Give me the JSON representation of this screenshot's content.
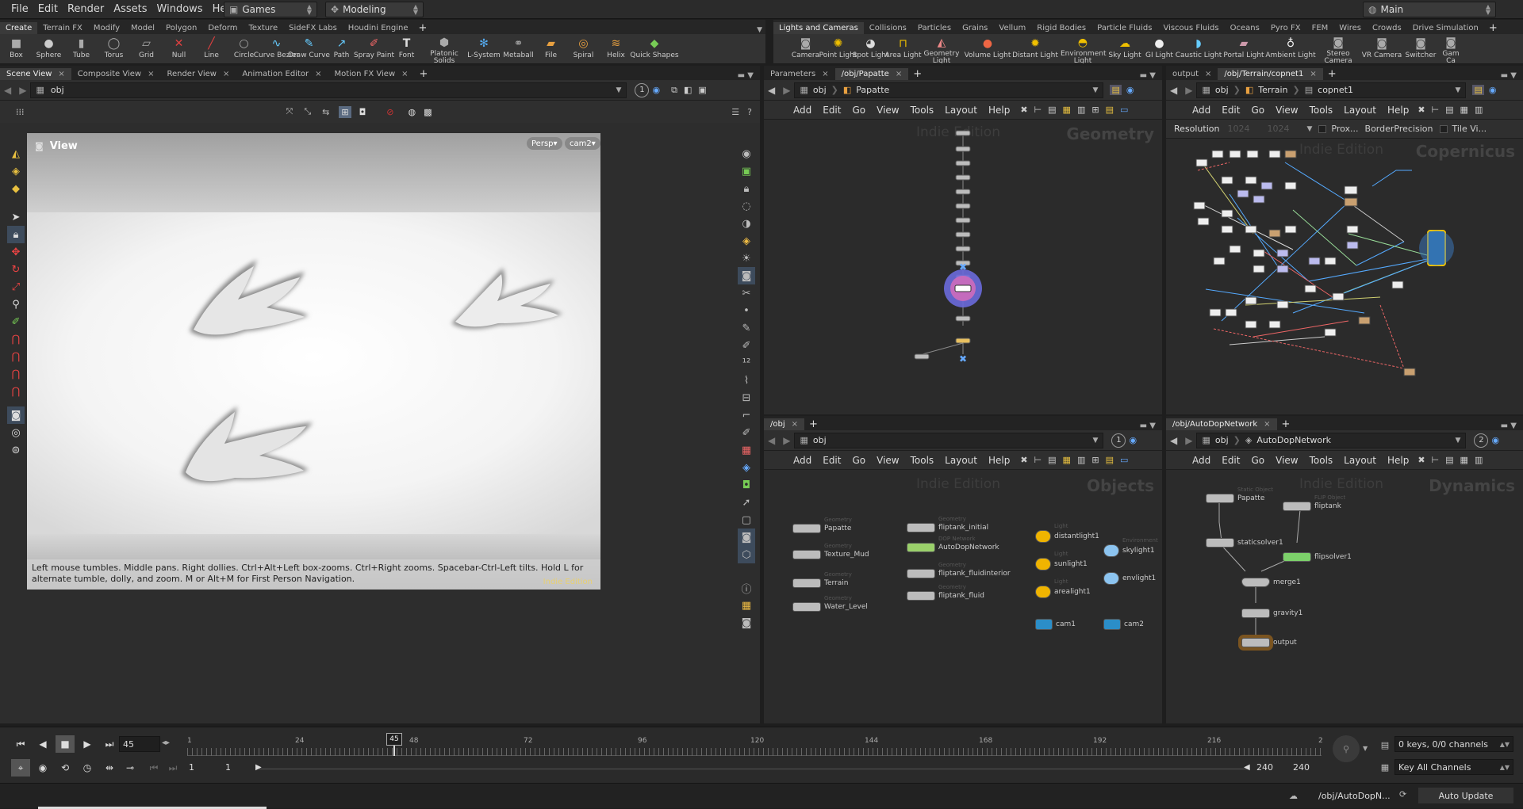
{
  "menubar": {
    "items": [
      "File",
      "Edit",
      "Render",
      "Assets",
      "Windows",
      "Help"
    ],
    "desktop": "Games",
    "context": "Modeling",
    "main": "Main"
  },
  "shelf_left": {
    "tabs": [
      "Create",
      "Terrain FX",
      "Modify",
      "Model",
      "Polygon",
      "Deform",
      "Texture",
      "SideFX Labs",
      "Houdini Engine"
    ],
    "tools": [
      "Box",
      "Sphere",
      "Tube",
      "Torus",
      "Grid",
      "Null",
      "Line",
      "Circle",
      "Curve Bezier",
      "Draw Curve",
      "Path",
      "Spray Paint",
      "Font",
      "Platonic Solids",
      "L-System",
      "Metaball",
      "File",
      "Spiral",
      "Helix",
      "Quick Shapes"
    ]
  },
  "shelf_right": {
    "tabs": [
      "Lights and Cameras",
      "Collisions",
      "Particles",
      "Grains",
      "Vellum",
      "Rigid Bodies",
      "Particle Fluids",
      "Viscous Fluids",
      "Oceans",
      "Pyro FX",
      "FEM",
      "Wires",
      "Crowds",
      "Drive Simulation"
    ],
    "tools": [
      "Camera",
      "Point Light",
      "Spot Light",
      "Area Light",
      "Geometry Light",
      "Volume Light",
      "Distant Light",
      "Environment Light",
      "Sky Light",
      "GI Light",
      "Caustic Light",
      "Portal Light",
      "Ambient Light",
      "Stereo Camera",
      "VR Camera",
      "Switcher",
      "Gam Ca"
    ]
  },
  "scene_pane": {
    "tabs": [
      "Scene View",
      "Composite View",
      "Render View",
      "Animation Editor",
      "Motion FX View"
    ],
    "path": "obj",
    "badge": "1",
    "view_label": "View",
    "persp": "Persp",
    "cam": "cam2",
    "hint": "Left mouse tumbles. Middle pans. Right dollies. Ctrl+Alt+Left box-zooms. Ctrl+Right zooms. Spacebar-Ctrl-Left tilts. Hold L for alternate tumble, dolly, and zoom. M or Alt+M for First Person Navigation.",
    "edition": "Indie Edition"
  },
  "net_menu": [
    "Add",
    "Edit",
    "Go",
    "View",
    "Tools",
    "Layout",
    "Help"
  ],
  "pane_geo": {
    "tabs": [
      "Parameters",
      "/obj/Papatte"
    ],
    "path": [
      "obj",
      "Papatte"
    ],
    "watermark": "Indie Edition",
    "context": "Geometry"
  },
  "pane_cop": {
    "tabs": [
      "output",
      "/obj/Terrain/copnet1"
    ],
    "path": [
      "obj",
      "Terrain",
      "copnet1"
    ],
    "resolution_label": "Resolution",
    "res_x": "1024",
    "res_y": "1024",
    "prox": "Prox...",
    "border": "BorderPrecision",
    "tile": "Tile Vi...",
    "watermark": "Indie Edition",
    "context": "Copernicus"
  },
  "pane_obj": {
    "tabs": [
      "/obj"
    ],
    "path": "obj",
    "badge": "1",
    "watermark": "Indie Edition",
    "context": "Objects",
    "nodes": [
      {
        "type": "Geometry",
        "name": "Papatte"
      },
      {
        "type": "Geometry",
        "name": "Texture_Mud"
      },
      {
        "type": "Geometry",
        "name": "Terrain"
      },
      {
        "type": "Geometry",
        "name": "Water_Level"
      },
      {
        "type": "Geometry",
        "name": "fliptank_initial"
      },
      {
        "type": "DOP Network",
        "name": "AutoDopNetwork"
      },
      {
        "type": "Geometry",
        "name": "fliptank_fluidinterior"
      },
      {
        "type": "Geometry",
        "name": "fliptank_fluid"
      },
      {
        "type": "Light",
        "name": "distantlight1"
      },
      {
        "type": "Light",
        "name": "sunlight1"
      },
      {
        "type": "Light",
        "name": "arealight1"
      },
      {
        "type": "Environment",
        "name": "skylight1"
      },
      {
        "type": "",
        "name": "envlight1"
      },
      {
        "type": "",
        "name": "cam1"
      },
      {
        "type": "",
        "name": "cam2"
      }
    ]
  },
  "pane_dop": {
    "tabs": [
      "/obj/AutoDopNetwork"
    ],
    "path": [
      "obj",
      "AutoDopNetwork"
    ],
    "badge": "2",
    "watermark": "Indie Edition",
    "context": "Dynamics",
    "nodes": [
      {
        "type": "Static Object",
        "name": "Papatte"
      },
      {
        "type": "FLIP Object",
        "name": "fliptank"
      },
      {
        "type": "",
        "name": "staticsolver1"
      },
      {
        "type": "",
        "name": "flipsolver1"
      },
      {
        "type": "",
        "name": "merge1"
      },
      {
        "type": "",
        "name": "gravity1"
      },
      {
        "type": "",
        "name": "output"
      }
    ]
  },
  "timeline": {
    "frame": "45",
    "marker": "45",
    "ticks": [
      "1",
      "24",
      "48",
      "72",
      "96",
      "120",
      "144",
      "168",
      "192",
      "216",
      "2"
    ],
    "start": "1",
    "start2": "1",
    "end": "240",
    "end2": "240",
    "keys": "0 keys, 0/0 channels",
    "key_all": "Key All Channels",
    "status_path": "/obj/AutoDopN...",
    "auto_update": "Auto Update"
  },
  "colors": {
    "selected_node": "#f2c200",
    "viewport_sky": "#a8a8a8",
    "mud": "#f2f2f2"
  }
}
